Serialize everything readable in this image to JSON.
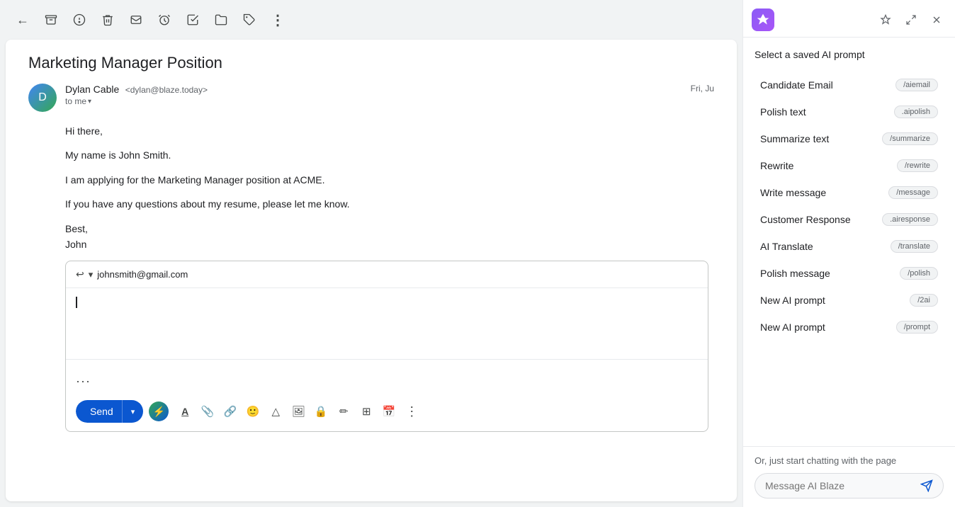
{
  "toolbar": {
    "icons": [
      {
        "name": "back-icon",
        "symbol": "←"
      },
      {
        "name": "archive-icon",
        "symbol": "🗄"
      },
      {
        "name": "snooze-icon",
        "symbol": "🕐"
      },
      {
        "name": "delete-icon",
        "symbol": "🗑"
      },
      {
        "name": "email-icon",
        "symbol": "✉"
      },
      {
        "name": "clock-icon",
        "symbol": "⏱"
      },
      {
        "name": "mark-icon",
        "symbol": "✓"
      },
      {
        "name": "folder-icon",
        "symbol": "📁"
      },
      {
        "name": "label-icon",
        "symbol": "🏷"
      },
      {
        "name": "more-icon",
        "symbol": "⋮"
      }
    ]
  },
  "email": {
    "subject": "Marketing Manager Position",
    "sender_name": "Dylan Cable",
    "sender_email": "<dylan@blaze.today>",
    "to_label": "to me",
    "date": "Fri, Ju",
    "avatar_letter": "D",
    "body": [
      "Hi there,",
      "My name is John Smith.",
      "I am applying for the Marketing Manager position at ACME.",
      "If you have any questions about my resume, please let me know.",
      "Best,",
      "John"
    ]
  },
  "reply": {
    "to_address": "johnsmith@gmail.com",
    "send_label": "Send",
    "toolbar_icons": [
      {
        "name": "format-text-icon",
        "symbol": "A"
      },
      {
        "name": "attach-icon",
        "symbol": "📎"
      },
      {
        "name": "link-icon",
        "symbol": "🔗"
      },
      {
        "name": "emoji-icon",
        "symbol": "😊"
      },
      {
        "name": "drive-icon",
        "symbol": "△"
      },
      {
        "name": "photo-icon",
        "symbol": "🖼"
      },
      {
        "name": "lock-icon",
        "symbol": "🔒"
      },
      {
        "name": "pen-icon",
        "symbol": "✏"
      },
      {
        "name": "table-icon",
        "symbol": "⊞"
      },
      {
        "name": "schedule-icon",
        "symbol": "📅"
      },
      {
        "name": "more-options-icon",
        "symbol": "⋮"
      }
    ]
  },
  "sidebar": {
    "title": "Select a saved AI prompt",
    "prompts": [
      {
        "name": "Candidate Email",
        "tag": "/aiemail"
      },
      {
        "name": "Polish text",
        "tag": ".aipolish"
      },
      {
        "name": "Summarize text",
        "tag": "/summarize"
      },
      {
        "name": "Rewrite",
        "tag": "/rewrite"
      },
      {
        "name": "Write message",
        "tag": "/message"
      },
      {
        "name": "Customer Response",
        "tag": ".airesponse"
      },
      {
        "name": "AI Translate",
        "tag": "/translate"
      },
      {
        "name": "Polish message",
        "tag": "/polish"
      },
      {
        "name": "New AI prompt",
        "tag": "/2ai"
      },
      {
        "name": "New AI prompt",
        "tag": "/prompt"
      }
    ],
    "chat_label": "Or, just start chatting with the page",
    "chat_placeholder": "Message AI Blaze"
  }
}
